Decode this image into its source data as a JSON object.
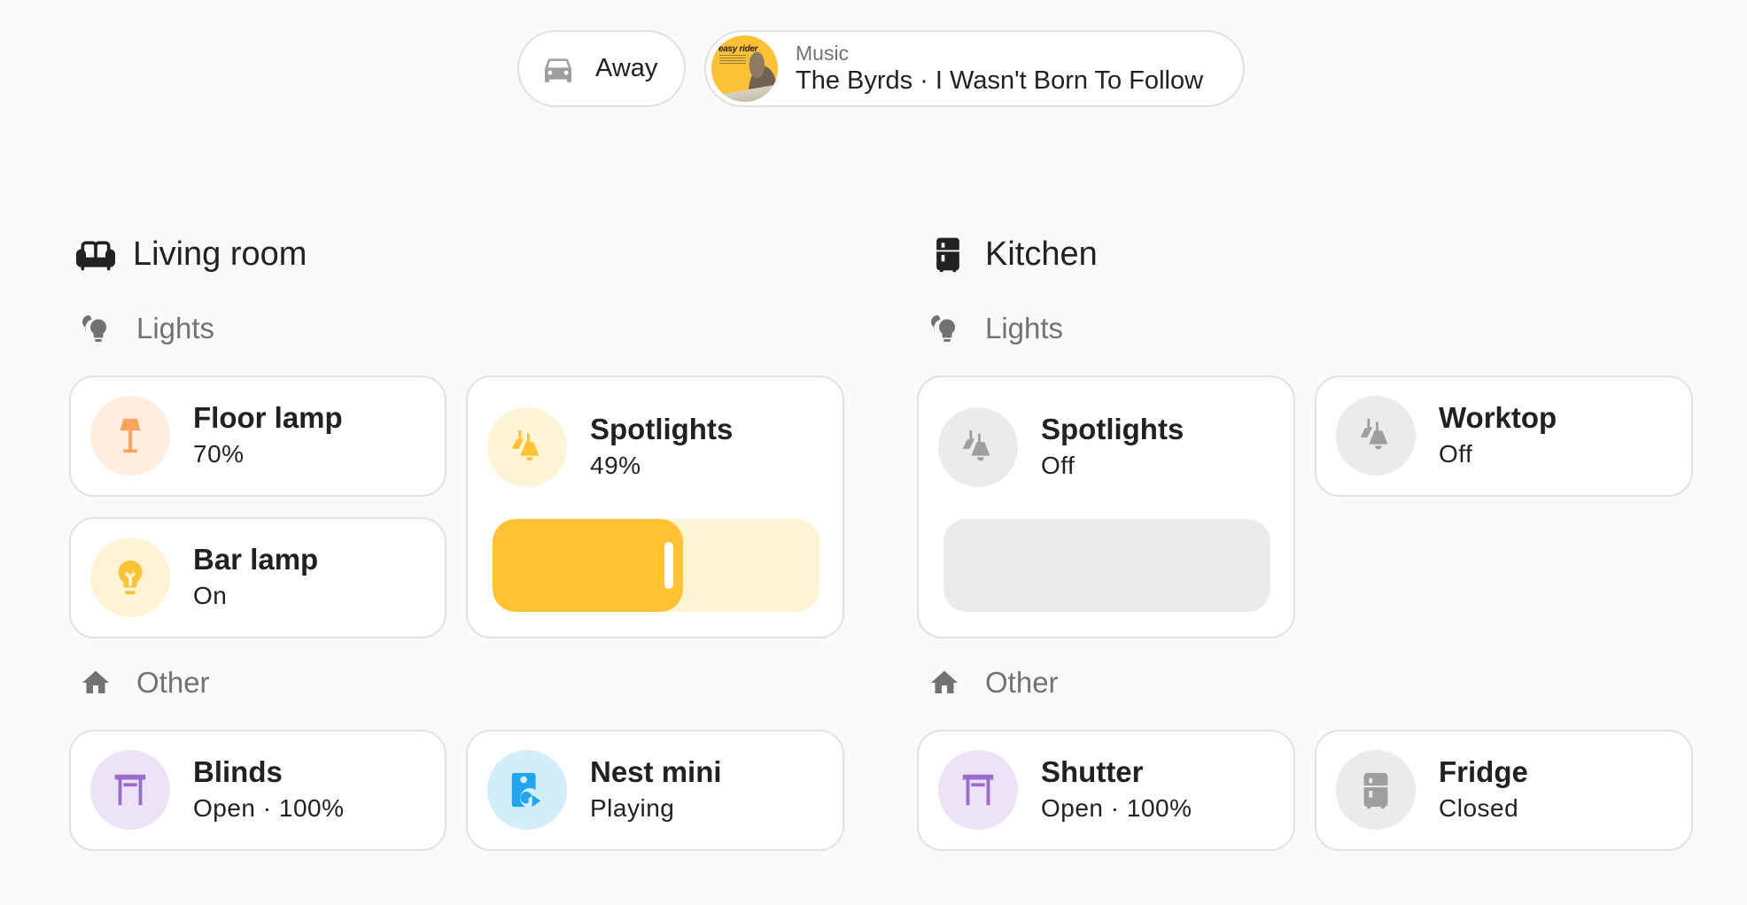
{
  "top_chips": {
    "presence": {
      "icon": "car-icon",
      "label": "Away"
    },
    "media": {
      "icon": "album-art",
      "category": "Music",
      "album_art_text": "easy rider",
      "now_playing": "The Byrds · I Wasn't Born To Follow"
    }
  },
  "colors": {
    "background": "#fafafa",
    "card": "#ffffff",
    "card_border": "#e1e1e1",
    "light_on": "#ffc233",
    "light_on_bg": "#fff3d6",
    "floor_lamp": "#ffa25a",
    "floor_lamp_bg": "#ffede0",
    "cover": "#9c6bd1",
    "cover_bg": "#ece3f6",
    "media": "#1ea7f0",
    "media_bg": "#d3edfb",
    "off": "#9e9e9e",
    "off_bg": "#ebebeb",
    "section_text": "#727272",
    "title_text": "#212121"
  },
  "rooms": [
    {
      "title": "Living room",
      "icon": "sofa-icon",
      "sections": [
        {
          "title": "Lights",
          "icon": "lightbulb-group-icon",
          "tiles": [
            {
              "name": "Floor lamp",
              "state": "70%",
              "icon": "floor-lamp-icon",
              "on": true
            },
            {
              "name": "Bar lamp",
              "state": "On",
              "icon": "lightbulb-icon",
              "on": true
            },
            {
              "name": "Spotlights",
              "state": "49%",
              "icon": "ceiling-light-multiple-icon",
              "on": true,
              "brightness_percent": 49
            }
          ]
        },
        {
          "title": "Other",
          "icon": "home-icon",
          "tiles": [
            {
              "name": "Blinds",
              "state": "Open · 100%",
              "icon": "window-shutter-icon"
            },
            {
              "name": "Nest mini",
              "state": "Playing",
              "icon": "speaker-play-icon"
            }
          ]
        }
      ]
    },
    {
      "title": "Kitchen",
      "icon": "fridge-icon",
      "sections": [
        {
          "title": "Lights",
          "icon": "lightbulb-group-icon",
          "tiles": [
            {
              "name": "Spotlights",
              "state": "Off",
              "icon": "ceiling-light-multiple-icon",
              "on": false,
              "brightness_percent": 0
            },
            {
              "name": "Worktop",
              "state": "Off",
              "icon": "ceiling-light-multiple-icon",
              "on": false
            }
          ]
        },
        {
          "title": "Other",
          "icon": "home-icon",
          "tiles": [
            {
              "name": "Shutter",
              "state": "Open · 100%",
              "icon": "window-shutter-icon"
            },
            {
              "name": "Fridge",
              "state": "Closed",
              "icon": "fridge-icon"
            }
          ]
        }
      ]
    }
  ]
}
